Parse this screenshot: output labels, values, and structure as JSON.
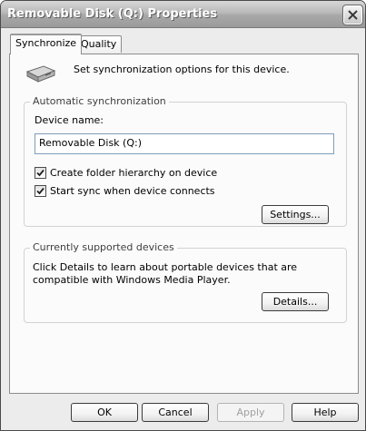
{
  "window": {
    "title": "Removable Disk (Q:) Properties",
    "close_icon": "close-icon"
  },
  "tabs": [
    {
      "label": "Synchronize",
      "selected": true
    },
    {
      "label": "Quality",
      "selected": false
    }
  ],
  "synchronize": {
    "device_icon": "removable-disk-icon",
    "intro": "Set synchronization options for this device.",
    "auto_group": {
      "legend": "Automatic synchronization",
      "device_name_label": "Device name:",
      "device_name_value": "Removable Disk (Q:)",
      "create_folder_label": "Create folder hierarchy on device",
      "create_folder_checked": true,
      "start_sync_label": "Start sync when device connects",
      "start_sync_checked": true,
      "settings_button": "Settings..."
    },
    "devices_group": {
      "legend": "Currently supported devices",
      "text": "Click Details to learn about portable devices that are compatible with Windows Media Player.",
      "details_button": "Details..."
    }
  },
  "footer": {
    "ok": "OK",
    "cancel": "Cancel",
    "apply": "Apply",
    "apply_enabled": false,
    "help": "Help"
  },
  "colors": {
    "window_background": "#ececec",
    "panel_background": "#fbfbfb",
    "textbox_border": "#7f9db9"
  }
}
